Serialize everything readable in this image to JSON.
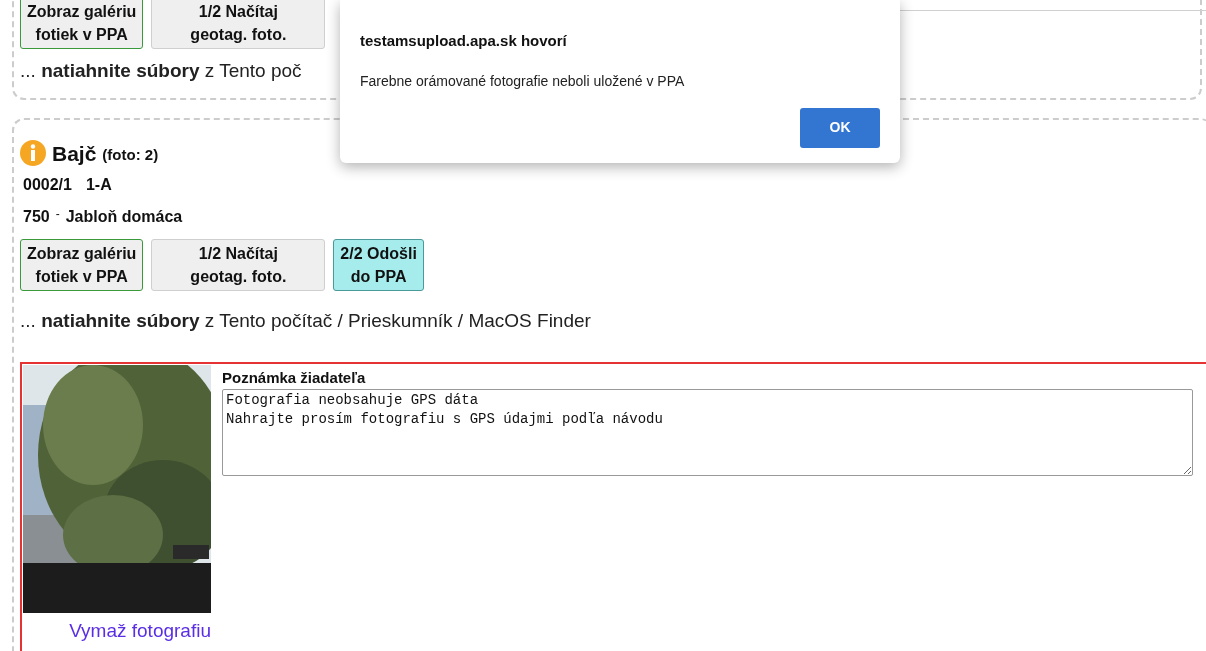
{
  "dialog": {
    "title": "testamsupload.apa.sk hovorí",
    "message": "Farebne orámované fotografie neboli uložené v PPA",
    "ok_button": "OK"
  },
  "cards": [
    {
      "buttons": [
        {
          "kind": "gallery",
          "lines": [
            "Zobraz galériu",
            "fotiek v PPA"
          ]
        },
        {
          "kind": "load",
          "lines": [
            "1/2 Načítaj",
            "geotag. foto."
          ]
        }
      ],
      "drop_hint": "... **natiahnite súbory** z Tento poč"
    },
    {
      "header": {
        "title": "Bajč",
        "count": "(foto: 2)",
        "parcel": "0002/1",
        "block": "1-A",
        "code": "750",
        "separator": "-",
        "crop": "Jabloň domáca"
      },
      "buttons": [
        {
          "kind": "gallery",
          "lines": [
            "Zobraz galériu",
            "fotiek v PPA"
          ]
        },
        {
          "kind": "load",
          "lines": [
            "1/2 Načítaj",
            "geotag. foto."
          ]
        },
        {
          "kind": "send",
          "lines": [
            "2/2 Odošli",
            "do PPA"
          ]
        }
      ],
      "drop_hint": "... **natiahnite súbory** z Tento počítač / Prieskumník / MacOS Finder",
      "photos": [
        {
          "kind": "picture",
          "saved": false,
          "note_label": "Poznámka žiadateľa",
          "note": "Fotografia neobsahuje GPS dáta\nNahrajte prosím fotografiu s GPS údajmi podľa návodu",
          "delete_link": "Vymaž fotografiu"
        }
      ]
    }
  ]
}
